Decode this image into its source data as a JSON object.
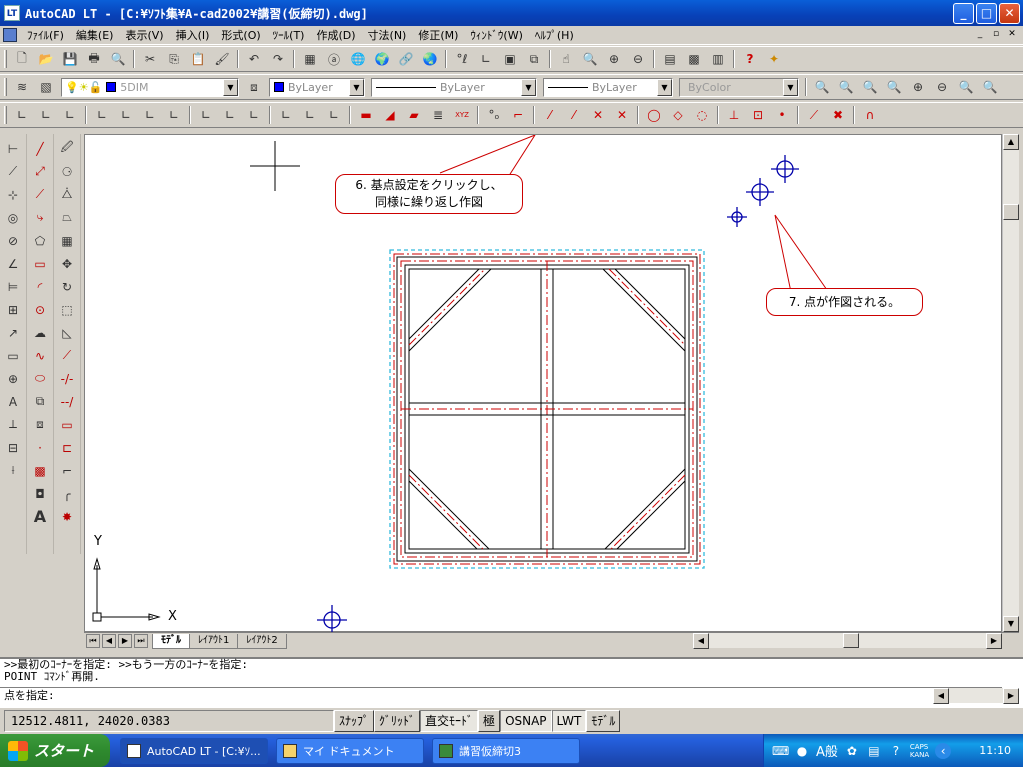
{
  "window": {
    "app_icon": "LT",
    "title": "AutoCAD LT - [C:¥ｿﾌﾄ集¥A-cad2002¥講習(仮締切).dwg]",
    "buttons": [
      "minimize-icon",
      "maximize-icon",
      "close-icon"
    ]
  },
  "menubar": {
    "items": [
      "ﾌｧｲﾙ(F)",
      "編集(E)",
      "表示(V)",
      "挿入(I)",
      "形式(O)",
      "ﾂｰﾙ(T)",
      "作成(D)",
      "寸法(N)",
      "修正(M)",
      "ｳｨﾝﾄﾞｳ(W)",
      "ﾍﾙﾌﾟ(H)"
    ]
  },
  "layers": {
    "current_layer": "5DIM",
    "color": "ByLayer",
    "linetype": "ByLayer",
    "lineweight": "ByLayer",
    "plotstyle": "ByColor"
  },
  "drawing": {
    "ucs_x": "X",
    "ucs_y": "Y",
    "callout1_line1": "6. 基点設定をクリックし、",
    "callout1_line2": "同様に繰り返し作図",
    "callout2": "7. 点が作図される。"
  },
  "tabs": [
    "ﾓﾃﾞﾙ",
    "ﾚｲｱｳﾄ1",
    "ﾚｲｱｳﾄ2"
  ],
  "command": {
    "history1": ">>最初のｺｰﾅｰを指定: >>もう一方のｺｰﾅｰを指定:",
    "history2": "POINT ｺﾏﾝﾄﾞ再開.",
    "prompt": "点を指定:"
  },
  "status": {
    "coords": "12512.4811, 24020.0383",
    "buttons": [
      "ｽﾅｯﾌﾟ",
      "ｸﾞﾘｯﾄﾞ",
      "直交ﾓｰﾄﾞ",
      "極",
      "OSNAP",
      "LWT",
      "ﾓﾃﾞﾙ"
    ]
  },
  "taskbar": {
    "start": "スタート",
    "tasks": [
      "AutoCAD LT - [C:¥ｿ...",
      "マイ ドキュメント",
      "講習仮締切3"
    ],
    "ime": "A般",
    "caps": "CAPS",
    "kana": "KANA",
    "clock": "11:10"
  },
  "colors": {
    "frame_red": "#cc0000",
    "dash_cyan": "#33bbdd",
    "point_blue": "#0000aa"
  }
}
